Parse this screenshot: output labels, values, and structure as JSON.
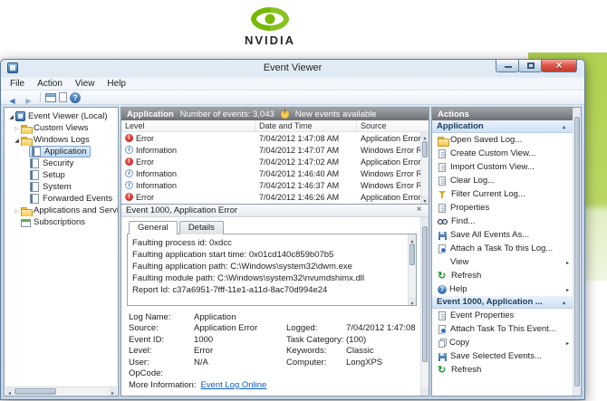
{
  "brand": {
    "logo_text": "NVIDIA"
  },
  "titlebar": {
    "title": "Event Viewer"
  },
  "menubar": {
    "file": "File",
    "action": "Action",
    "view": "View",
    "help": "Help"
  },
  "tree": {
    "root": "Event Viewer (Local)",
    "custom_views": "Custom Views",
    "windows_logs": "Windows Logs",
    "application": "Application",
    "security": "Security",
    "setup": "Setup",
    "system": "System",
    "forwarded_events": "Forwarded Events",
    "apps_services": "Applications and Services Log",
    "subscriptions": "Subscriptions"
  },
  "list": {
    "title": "Application",
    "count_text": "Number of events: 3,043",
    "new_events_text": "New events available",
    "columns": {
      "level": "Level",
      "datetime": "Date and Time",
      "source": "Source"
    },
    "rows": [
      {
        "level": "Error",
        "datetime": "7/04/2012 1:47:08 AM",
        "source": "Application Error"
      },
      {
        "level": "Information",
        "datetime": "7/04/2012 1:47:07 AM",
        "source": "Windows Error Reporting"
      },
      {
        "level": "Error",
        "datetime": "7/04/2012 1:47:02 AM",
        "source": "Application Error"
      },
      {
        "level": "Information",
        "datetime": "7/04/2012 1:46:40 AM",
        "source": "Windows Error Reporting"
      },
      {
        "level": "Information",
        "datetime": "7/04/2012 1:46:37 AM",
        "source": "Windows Error Reporting"
      },
      {
        "level": "Error",
        "datetime": "7/04/2012 1:46:26 AM",
        "source": "Application Error"
      }
    ]
  },
  "preview": {
    "title": "Event 1000, Application Error",
    "tabs": {
      "general": "General",
      "details": "Details"
    },
    "lines": [
      "Faulting process id: 0xdcc",
      "Faulting application start time: 0x01cd140c859b07b5",
      "Faulting application path: C:\\Windows\\system32\\dwm.exe",
      "Faulting module path: C:\\Windows\\system32\\nvumdshimx.dll",
      "Report Id: c37a6951-7fff-11e1-a11d-8ac70d994e24"
    ],
    "fields": {
      "log_name_label": "Log Name:",
      "log_name": "Application",
      "source_label": "Source:",
      "source": "Application Error",
      "logged_label": "Logged:",
      "logged": "7/04/2012 1:47:08 AM",
      "event_id_label": "Event ID:",
      "event_id": "1000",
      "task_category_label": "Task Category:",
      "task_category": "(100)",
      "level_label": "Level:",
      "level": "Error",
      "keywords_label": "Keywords:",
      "keywords": "Classic",
      "user_label": "User:",
      "user": "N/A",
      "computer_label": "Computer:",
      "computer": "LongXPS",
      "opcode_label": "OpCode:",
      "more_info_label": "More Information:",
      "more_info_link": "Event Log Online"
    }
  },
  "actions": {
    "title": "Actions",
    "group1": {
      "title": "Application",
      "items": [
        "Open Saved Log...",
        "Create Custom View...",
        "Import Custom View...",
        "Clear Log...",
        "Filter Current Log...",
        "Properties",
        "Find...",
        "Save All Events As...",
        "Attach a Task To this Log...",
        "View",
        "Refresh",
        "Help"
      ]
    },
    "group2": {
      "title": "Event 1000, Application ...",
      "items": [
        "Event Properties",
        "Attach Task To This Event...",
        "Copy",
        "Save Selected Events...",
        "Refresh"
      ]
    }
  }
}
